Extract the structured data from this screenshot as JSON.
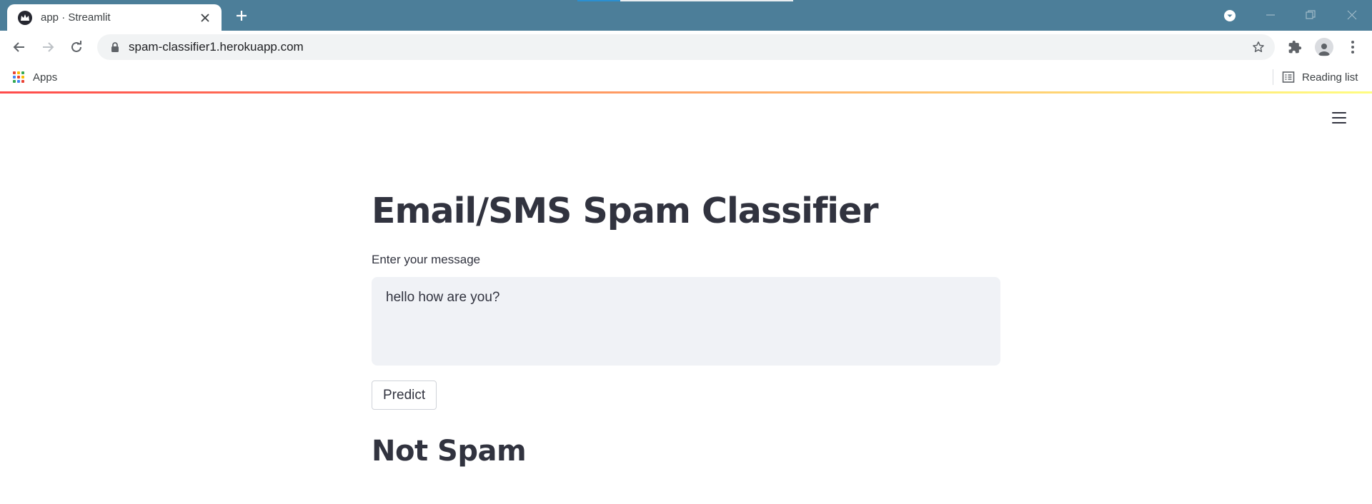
{
  "browser": {
    "tab": {
      "title": "app · Streamlit"
    },
    "url": "spam-classifier1.herokuapp.com",
    "bookmarks": {
      "apps_label": "Apps",
      "reading_list_label": "Reading list"
    },
    "colors": {
      "titlebar": "#4c7e99",
      "omnibox": "#f1f3f4"
    }
  },
  "app": {
    "title": "Email/SMS Spam Classifier",
    "input": {
      "label": "Enter your message",
      "value": "hello how are you?"
    },
    "predict_button": "Predict",
    "result": "Not Spam",
    "colors": {
      "text": "#31333f",
      "input_bg": "#f0f2f6",
      "decoration_start": "#ff4b4b",
      "decoration_end": "#fffd80"
    }
  },
  "icons": [
    "streamlit-favicon",
    "close-icon",
    "plus-icon",
    "tab-search-icon",
    "minimize-icon",
    "maximize-icon",
    "window-close-icon",
    "back-arrow-icon",
    "forward-arrow-icon",
    "reload-icon",
    "lock-icon",
    "star-icon",
    "puzzle-icon",
    "profile-icon",
    "more-vert-icon",
    "apps-grid-icon",
    "reading-list-icon",
    "hamburger-menu-icon"
  ]
}
